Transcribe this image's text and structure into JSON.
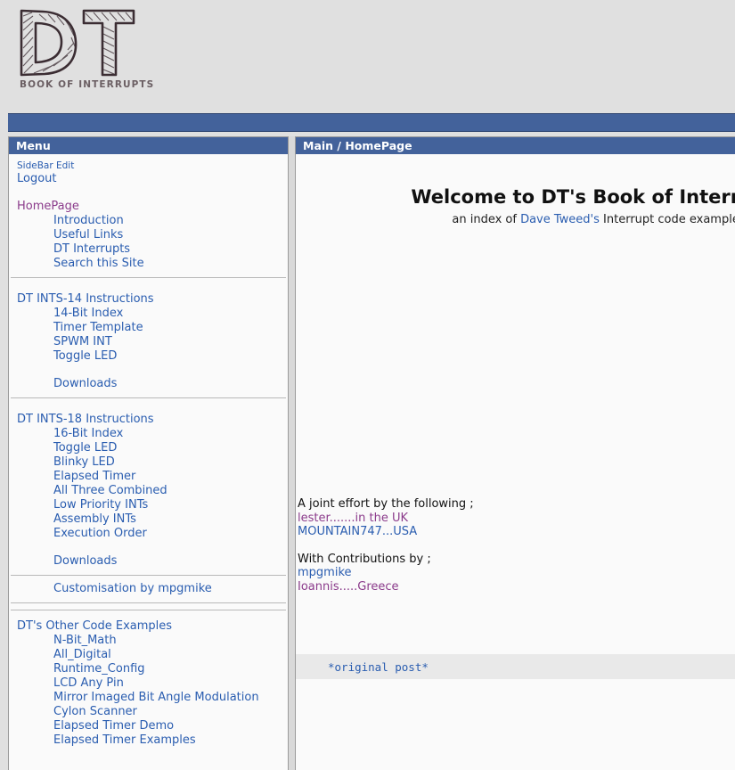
{
  "site": {
    "logo_letters": "DT",
    "logo_subtitle": "BOOK OF INTERRUPTS"
  },
  "sidebar": {
    "title": "Menu",
    "top_links": [
      {
        "label": "SideBar Edit",
        "style": "small",
        "visited": false
      },
      {
        "label": "Logout",
        "style": "normal",
        "visited": false
      }
    ],
    "sections": [
      {
        "header": {
          "label": "HomePage",
          "visited": true
        },
        "items": [
          {
            "label": "Introduction"
          },
          {
            "label": "Useful Links"
          },
          {
            "label": "DT Interrupts"
          },
          {
            "label": "Search this Site"
          }
        ]
      },
      {
        "header": {
          "label": "DT INTS-14 Instructions",
          "visited": false
        },
        "items": [
          {
            "label": "14-Bit Index"
          },
          {
            "label": "Timer Template"
          },
          {
            "label": "SPWM INT"
          },
          {
            "label": "Toggle LED"
          }
        ],
        "extra": "Downloads"
      },
      {
        "header": {
          "label": "DT INTS-18 Instructions",
          "visited": false
        },
        "items": [
          {
            "label": "16-Bit Index"
          },
          {
            "label": "Toggle LED"
          },
          {
            "label": "Blinky LED"
          },
          {
            "label": "Elapsed Timer"
          },
          {
            "label": "All Three Combined"
          },
          {
            "label": "Low Priority INTs"
          },
          {
            "label": "Assembly INTs"
          },
          {
            "label": "Execution Order"
          }
        ],
        "extra": "Downloads"
      }
    ],
    "customisation": "Customisation by mpgmike",
    "other_section": {
      "header": {
        "label": "DT's Other Code Examples",
        "visited": false
      },
      "items": [
        {
          "label": "N-Bit_Math"
        },
        {
          "label": "All_Digital"
        },
        {
          "label": "Runtime_Config"
        },
        {
          "label": "LCD Any Pin"
        },
        {
          "label": "Mirror Imaged Bit Angle Modulation"
        },
        {
          "label": "Cylon Scanner"
        },
        {
          "label": "Elapsed Timer Demo"
        },
        {
          "label": "Elapsed Timer Examples"
        }
      ]
    }
  },
  "main": {
    "title": "Main / HomePage",
    "welcome_heading": "Welcome to DT's Book of Interrupts",
    "subtitle_prefix": "an index of ",
    "subtitle_link": "Dave Tweed's",
    "subtitle_suffix": " Interrupt code examples",
    "credits": {
      "line1": "A joint effort by the following ;",
      "author1": "lester.......in the UK",
      "author2": "MOUNTAIN747...USA",
      "line2": "With Contributions by ;",
      "contrib1": "mpgmike",
      "contrib2": "Ioannis.....Greece"
    },
    "code_link": "*original post*"
  },
  "colors": {
    "accent_blue": "#43629b",
    "link_blue": "#2a5db0",
    "visited_purple": "#8b3b8b",
    "page_bg": "#e0e0e0",
    "panel_bg": "#fafafa",
    "code_bg": "#e9e9e9"
  }
}
